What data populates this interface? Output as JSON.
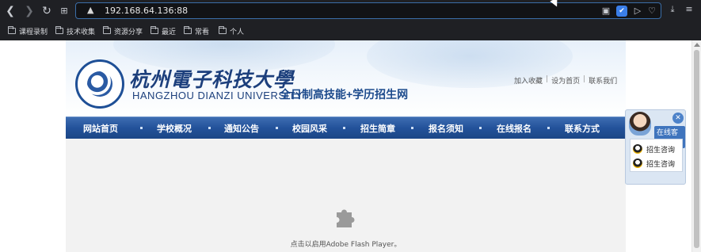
{
  "browser": {
    "url": "192.168.64.136:88",
    "nav_icons": {
      "back": "back-icon",
      "forward": "forward-icon",
      "reload": "reload-icon",
      "tabs": "tab-grid-icon"
    },
    "omnibox_icons": [
      "camera-icon",
      "shield-icon",
      "send-icon",
      "heart-icon"
    ],
    "right_icons": [
      "download-icon",
      "menu-icon"
    ],
    "bookmarks": [
      "课程录制",
      "技术收集",
      "资源分享",
      "最近",
      "常看",
      "个人"
    ]
  },
  "site": {
    "name_cn": "杭州電子科技大學",
    "name_en": "HANGZHOU DIANZI UNIVERSITY",
    "subtitle": "全日制高技能+学历招生网",
    "top_links": [
      "加入收藏",
      "设为首页",
      "联系我们"
    ],
    "nav": [
      "网站首页",
      "学校概况",
      "通知公告",
      "校园风采",
      "招生简章",
      "报名须知",
      "在线报名",
      "联系方式"
    ],
    "flash_message": "点击以启用Adobe Flash Player。"
  },
  "widget": {
    "title": "在线客服",
    "items": [
      "招生咨询",
      "招生咨询"
    ]
  },
  "colors": {
    "nav_blue": "#23529a",
    "brand_blue": "#1c3f7c",
    "chrome_bg": "#1f2024"
  }
}
